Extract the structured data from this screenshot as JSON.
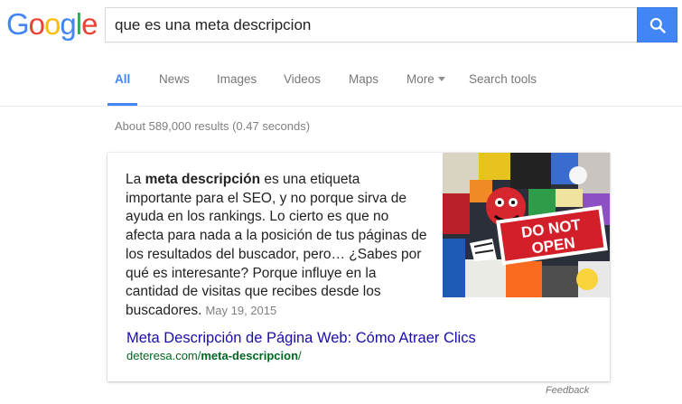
{
  "logo": {
    "letters": [
      "G",
      "o",
      "o",
      "g",
      "l",
      "e"
    ],
    "colors": [
      "#4285f4",
      "#ea4335",
      "#fbbc05",
      "#4285f4",
      "#34a853",
      "#ea4335"
    ]
  },
  "search": {
    "query": "que es una meta descripcion",
    "button_icon": "search-icon",
    "button_color": "#4285f4"
  },
  "tabs": [
    {
      "label": "All",
      "active": true
    },
    {
      "label": "News",
      "active": false
    },
    {
      "label": "Images",
      "active": false
    },
    {
      "label": "Videos",
      "active": false
    },
    {
      "label": "Maps",
      "active": false
    },
    {
      "label": "More",
      "active": false,
      "has_caret": true
    },
    {
      "label": "Search tools",
      "active": false
    }
  ],
  "result_stats": "About 589,000 results (0.47 seconds)",
  "snippet": {
    "before_bold": "La ",
    "bold": "meta descripción",
    "after_bold": " es una etiqueta importante para el SEO, y no porque sirva de ayuda en los rankings. Lo cierto es que no afecta para nada a la posición de tus páginas de los resultados del buscador, pero… ¿Sabes por qué es interesante? Porque influye en la cantidad de visitas que recibes desde los buscadores.",
    "date": "May 19, 2015",
    "image_caption": "DO NOT OPEN"
  },
  "result": {
    "title": "Meta Descripción de Página Web: Cómo Atraer Clics",
    "url_prefix": "deteresa.com/",
    "url_bold": "meta-descripcion",
    "url_suffix": "/"
  },
  "feedback": "Feedback"
}
